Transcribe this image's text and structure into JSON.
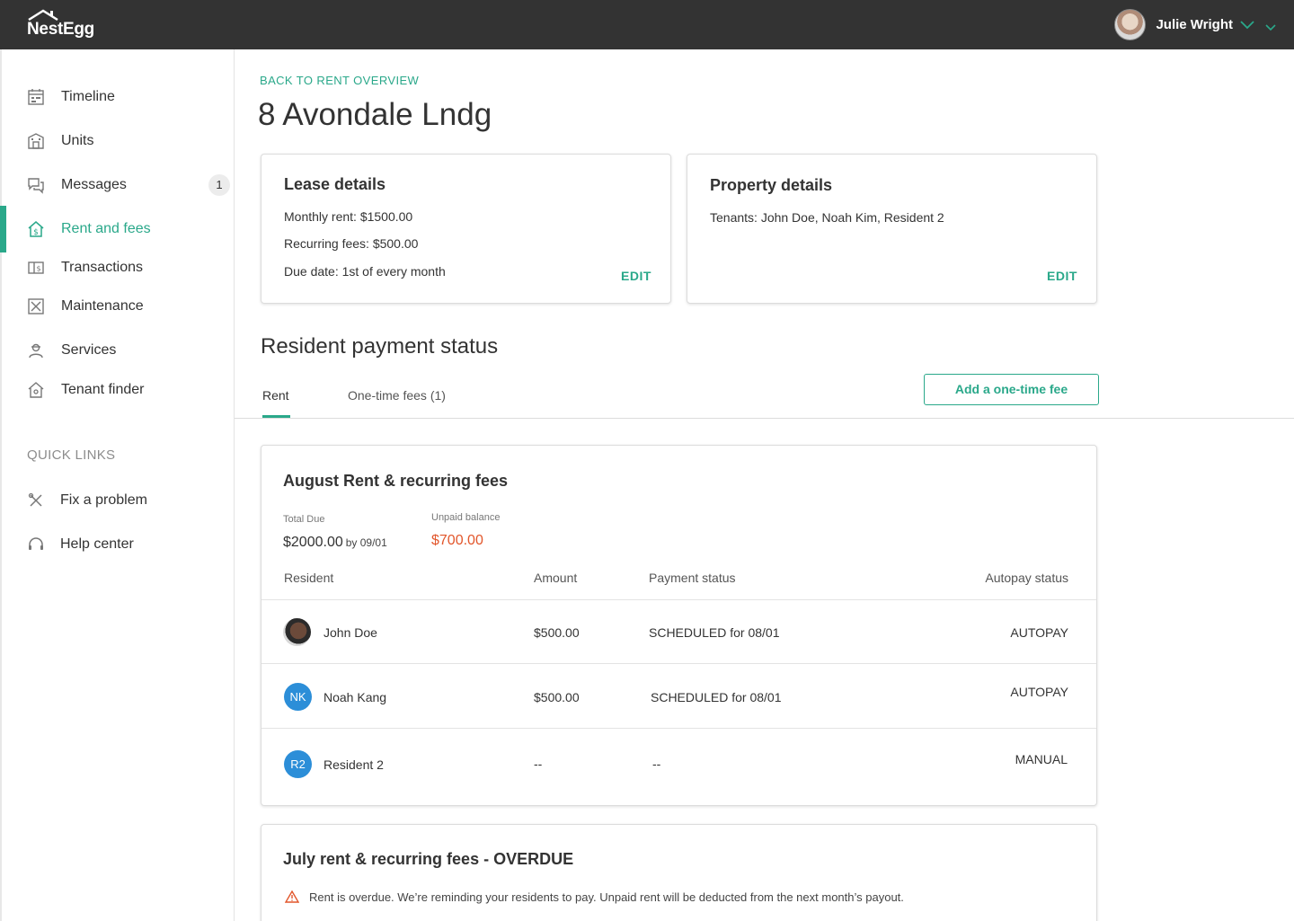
{
  "app": {
    "name": "NestEgg"
  },
  "user": {
    "name": "Julie Wright"
  },
  "sidebar": {
    "items": [
      {
        "label": "Timeline",
        "icon": "calendar-icon"
      },
      {
        "label": "Units",
        "icon": "building-icon"
      },
      {
        "label": "Messages",
        "icon": "chat-icon",
        "badge": "1"
      },
      {
        "label": "Rent and fees",
        "icon": "house-dollar-icon",
        "active": true
      },
      {
        "label": "Transactions",
        "icon": "money-icon"
      },
      {
        "label": "Maintenance",
        "icon": "tools-box-icon"
      },
      {
        "label": "Services",
        "icon": "worker-icon"
      },
      {
        "label": "Tenant finder",
        "icon": "house-search-icon"
      }
    ],
    "quick_links_title": "QUICK LINKS",
    "quick_links": [
      {
        "label": "Fix a problem",
        "icon": "wrench-icon"
      },
      {
        "label": "Help center",
        "icon": "headset-icon"
      }
    ]
  },
  "main": {
    "back_link": "BACK TO RENT OVERVIEW",
    "title": "8 Avondale Lndg",
    "lease": {
      "title": "Lease details",
      "monthly_rent": "Monthly rent: $1500.00",
      "recurring_fees": "Recurring fees: $500.00",
      "due_date": "Due date: 1st of every month",
      "edit": "EDIT"
    },
    "property": {
      "title": "Property details",
      "tenants": "Tenants: John Doe, Noah Kim, Resident 2",
      "edit": "EDIT"
    },
    "payment_status_title": "Resident payment status",
    "tabs": [
      {
        "label": "Rent",
        "active": true
      },
      {
        "label": "One-time fees (1)"
      }
    ],
    "add_fee_button": "Add a one-time fee",
    "august": {
      "title": "August Rent & recurring fees",
      "total_due_label": "Total Due",
      "total_due": "$2000.00",
      "total_due_by": "by 09/01",
      "unpaid_label": "Unpaid balance",
      "unpaid": "$700.00",
      "columns": [
        "Resident",
        "Amount",
        "Payment status",
        "Autopay status"
      ],
      "rows": [
        {
          "initials": "",
          "name": "John Doe",
          "amount": "$500.00",
          "status": "SCHEDULED for 08/01",
          "autopay": "AUTOPAY"
        },
        {
          "initials": "NK",
          "name": "Noah Kang",
          "amount": "$500.00",
          "status": "SCHEDULED for 08/01",
          "autopay": "AUTOPAY"
        },
        {
          "initials": "R2",
          "name": "Resident 2",
          "amount": "--",
          "status": "--",
          "autopay": "MANUAL"
        }
      ]
    },
    "july": {
      "title": "July rent & recurring fees - OVERDUE",
      "warning": "Rent is overdue. We’re reminding your residents to pay. Unpaid rent will be deducted from the next month’s payout."
    }
  },
  "colors": {
    "accent": "#2aa88a",
    "topbar": "#333333",
    "overdue": "#e2562b",
    "avatar": "#2c8ed8"
  }
}
